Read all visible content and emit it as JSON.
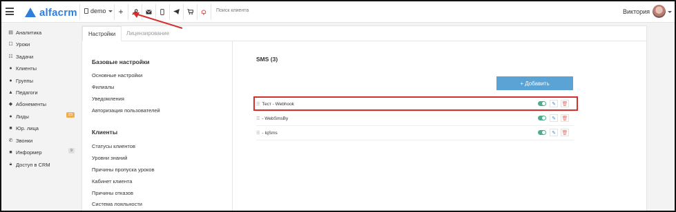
{
  "app": {
    "logo_text": "alfacrm",
    "brand_color": "#2f7fd8"
  },
  "topbar": {
    "demo_label": "demo",
    "search_placeholder": "Поиск клиента",
    "user_name": "Виктория",
    "icons": [
      "plus-icon",
      "wrench-icon",
      "mail-icon",
      "phone-icon",
      "telegram-icon",
      "cart-icon",
      "bell-icon"
    ]
  },
  "sidebar": {
    "items": [
      {
        "label": "Аналитика",
        "icon": "chart-icon"
      },
      {
        "label": "Уроки",
        "icon": "square-icon"
      },
      {
        "label": "Задачи",
        "icon": "tasks-icon"
      },
      {
        "label": "Клиенты",
        "icon": "user-icon"
      },
      {
        "label": "Группы",
        "icon": "users-icon"
      },
      {
        "label": "Педагоги",
        "icon": "graduation-icon"
      },
      {
        "label": "Абонементы",
        "icon": "tag-icon"
      },
      {
        "label": "Лиды",
        "icon": "people-icon",
        "badge": "23"
      },
      {
        "label": "Юр. лица",
        "icon": "briefcase-icon"
      },
      {
        "label": "Звонки",
        "icon": "phone-icon"
      },
      {
        "label": "Информер",
        "icon": "box-icon",
        "badge": "9"
      },
      {
        "label": "Доступ в CRM",
        "icon": "lock-icon"
      }
    ]
  },
  "tabs": [
    "Настройки",
    "Лицензирование"
  ],
  "settings": {
    "base_title": "Базовые настройки",
    "base_links": [
      "Основные настройки",
      "Филиалы",
      "Уведомления",
      "Авторизация пользователей"
    ],
    "clients_title": "Клиенты",
    "clients_links": [
      "Статусы клиентов",
      "Уровни знаний",
      "Причины пропуска уроков",
      "Кабинет клиента",
      "Причины отказов",
      "Система лояльности"
    ]
  },
  "sms": {
    "title": "SMS (3)",
    "add_label": "+ Добавить",
    "rows": [
      {
        "label": "Тест - Webhook",
        "enabled": true
      },
      {
        "label": "- WebSmsBy",
        "enabled": true
      },
      {
        "label": "- IqSms",
        "enabled": true
      }
    ]
  }
}
